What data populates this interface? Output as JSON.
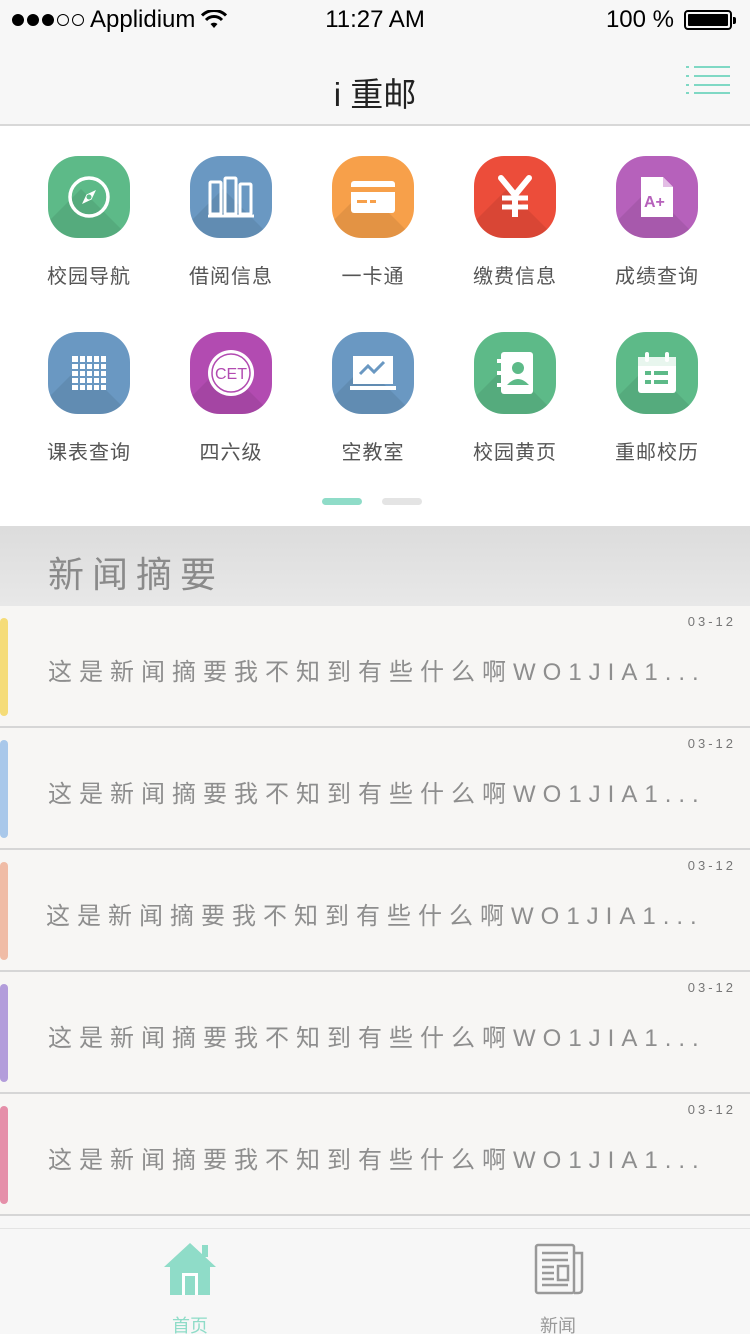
{
  "status_bar": {
    "carrier": "Applidium",
    "time": "11:27 AM",
    "battery": "100 %",
    "battery_level": 1.0
  },
  "nav": {
    "title": "i 重邮",
    "menu_icon": "list-menu-icon"
  },
  "grid": {
    "items": [
      {
        "label": "校园导航",
        "icon": "compass-icon",
        "color": "#5dba88"
      },
      {
        "label": "借阅信息",
        "icon": "books-icon",
        "color": "#6a98c2"
      },
      {
        "label": "一卡通",
        "icon": "card-icon",
        "color": "#f7a04a"
      },
      {
        "label": "缴费信息",
        "icon": "yen-icon",
        "color": "#ec4d3a"
      },
      {
        "label": "成绩查询",
        "icon": "grade-document-icon",
        "color": "#b661bb"
      },
      {
        "label": "课表查询",
        "icon": "timetable-grid-icon",
        "color": "#6a98c2"
      },
      {
        "label": "四六级",
        "icon": "cet-icon",
        "color": "#b24bb1"
      },
      {
        "label": "空教室",
        "icon": "blackboard-icon",
        "color": "#6a98c2"
      },
      {
        "label": "校园黄页",
        "icon": "contact-book-icon",
        "color": "#5dba88"
      },
      {
        "label": "重邮校历",
        "icon": "calendar-icon",
        "color": "#5dba88"
      }
    ],
    "cet_text": "CET",
    "grade_text": "A+",
    "pager": {
      "pages": 2,
      "current": 1,
      "active_color": "#8fdcc8",
      "inactive_color": "#e4e4e4"
    }
  },
  "news": {
    "header": "新闻摘要",
    "items": [
      {
        "date": "03-12",
        "text": "这是新闻摘要我不知到有些什么啊WO1JIA1...",
        "color": "#f5dc78"
      },
      {
        "date": "03-12",
        "text": "这是新闻摘要我不知到有些什么啊WO1JIA1...",
        "color": "#a9c8ea"
      },
      {
        "date": "03-12",
        "text": "这是新闻摘要我不知到有些什么啊WO1JIA1...",
        "color": "#f0bca6"
      },
      {
        "date": "03-12",
        "text": "这是新闻摘要我不知到有些什么啊WO1JIA1...",
        "color": "#b39ddb"
      },
      {
        "date": "03-12",
        "text": "这是新闻摘要我不知到有些什么啊WO1JIA1...",
        "color": "#e58fa9"
      }
    ]
  },
  "tab_bar": {
    "tabs": [
      {
        "label": "首页",
        "icon": "home-icon",
        "active": true
      },
      {
        "label": "新闻",
        "icon": "newspaper-icon",
        "active": false
      }
    ],
    "active_color": "#8fdcc8",
    "inactive_color": "#999999"
  }
}
